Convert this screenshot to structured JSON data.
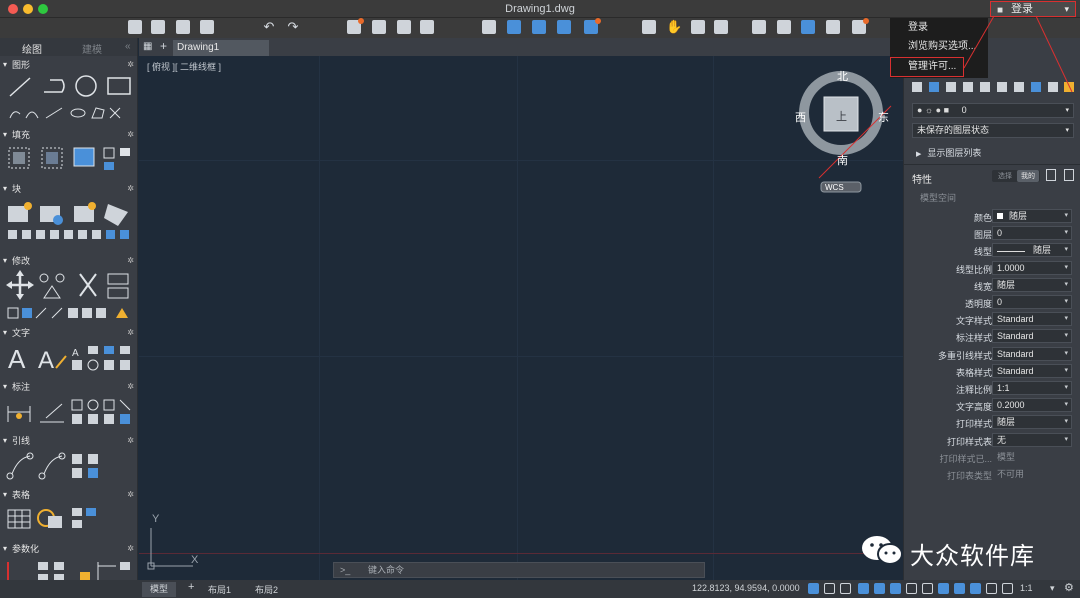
{
  "window": {
    "title": "Drawing1.dwg"
  },
  "login": {
    "button_label": "登录",
    "menu": [
      "登录",
      "浏览购买选项...",
      "管理许可..."
    ]
  },
  "palette": {
    "tabs": [
      "绘图",
      "建模"
    ],
    "sections": [
      "图形",
      "填充",
      "块",
      "修改",
      "文字",
      "标注",
      "引线",
      "表格",
      "参数化"
    ]
  },
  "document": {
    "tab": "Drawing1",
    "view_label": "[ 俯视 ][ 二维线框 ]"
  },
  "viewcube": {
    "north": "北",
    "south": "南",
    "east": "东",
    "west": "西",
    "top": "上",
    "wcs": "WCS"
  },
  "axes": {
    "x": "X",
    "y": "Y"
  },
  "command": {
    "placeholder": "键入命令",
    "prompt": ">_"
  },
  "statusbar": {
    "tabs": [
      "模型",
      "布局1",
      "布局2"
    ],
    "coords": "122.8123, 94.9594, 0.0000",
    "scale": "1:1"
  },
  "layers": {
    "current_layer": "0",
    "state": "未保存的图层状态",
    "show_list": "显示图层列表"
  },
  "properties": {
    "title": "特性",
    "toggle": [
      "选择",
      "我的"
    ],
    "space": "模型空间",
    "rows": [
      {
        "label": "颜色",
        "value": "随层",
        "swatch": true
      },
      {
        "label": "图层",
        "value": "0"
      },
      {
        "label": "线型",
        "value": "随层",
        "line": true
      },
      {
        "label": "线型比例",
        "value": "1.0000"
      },
      {
        "label": "线宽",
        "value": "随层"
      },
      {
        "label": "透明度",
        "value": "0"
      },
      {
        "label": "文字样式",
        "value": "Standard"
      },
      {
        "label": "标注样式",
        "value": "Standard"
      },
      {
        "label": "多重引线样式",
        "value": "Standard"
      },
      {
        "label": "表格样式",
        "value": "Standard"
      },
      {
        "label": "注释比例",
        "value": "1:1"
      },
      {
        "label": "文字高度",
        "value": "0.2000"
      },
      {
        "label": "打印样式",
        "value": "随层"
      },
      {
        "label": "打印样式表",
        "value": "无"
      },
      {
        "label": "打印样式已...",
        "value": "模型",
        "dim": true
      },
      {
        "label": "打印表类型",
        "value": "不可用",
        "dim": true
      }
    ]
  },
  "watermark": {
    "text": "大众软件库"
  },
  "colors": {
    "canvas": "#1e2a38",
    "panel": "#3a3e45",
    "accent": "#4a90d9",
    "highlight": "#d83030"
  }
}
